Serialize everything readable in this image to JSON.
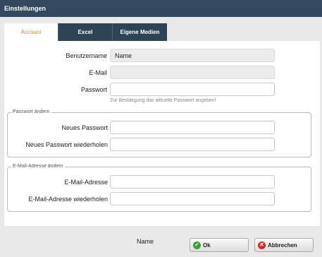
{
  "dialog": {
    "title": "Einstellungen"
  },
  "tabs": [
    {
      "label": "Account"
    },
    {
      "label": "Excel"
    },
    {
      "label": "Eigene Medien"
    }
  ],
  "account": {
    "username_label": "Benutzername",
    "username_value": "Name",
    "email_label": "E-Mail",
    "email_value": "",
    "password_label": "Passwort",
    "password_value": "",
    "password_hint": "Zur Bestätigung das aktuelle Passwort angeben!"
  },
  "change_password": {
    "legend": "Passwort ändern",
    "new_label": "Neues Passwort",
    "new_value": "",
    "repeat_label": "Neues Passwort wiederholen",
    "repeat_value": ""
  },
  "change_email": {
    "legend": "E-Mail-Adresse ändern",
    "new_label": "E-Mail-Adresse",
    "new_value": "",
    "repeat_label": "E-Mail-Adresse wiederholen",
    "repeat_value": ""
  },
  "footer": {
    "user_name": "Name",
    "ok_label": "Ok",
    "cancel_label": "Abbrechen"
  },
  "colors": {
    "titlebar": "#34495f",
    "active_tab_text": "#e8892a",
    "ok_icon": "#3aa13a",
    "cancel_icon": "#d62a2a"
  },
  "icons": {
    "ok": "check-icon",
    "cancel": "close-icon"
  }
}
